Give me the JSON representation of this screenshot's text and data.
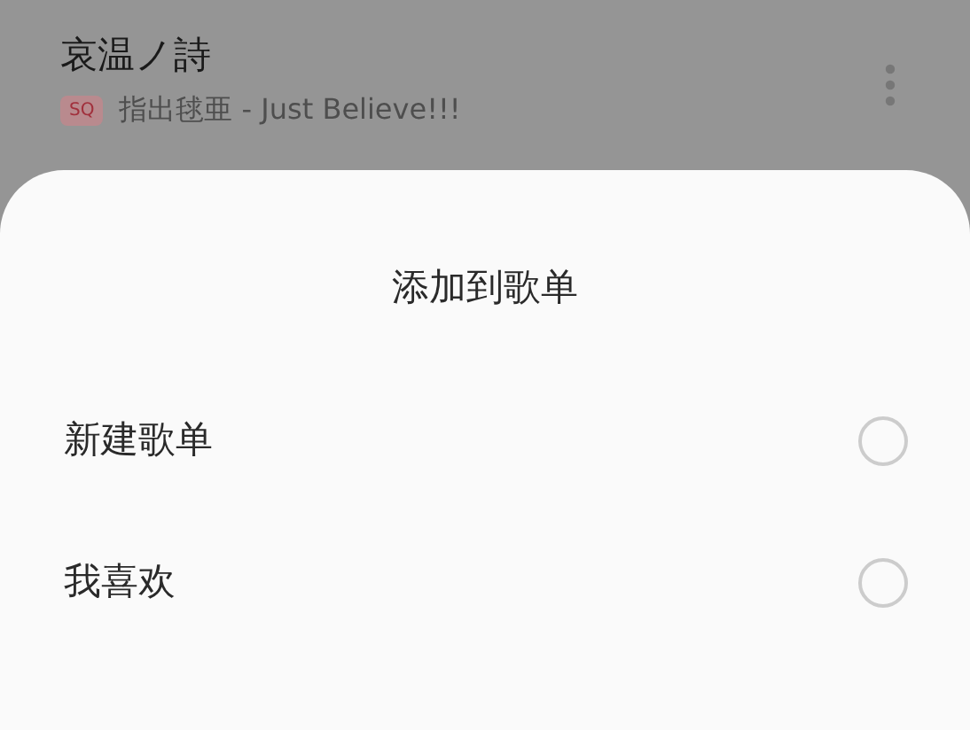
{
  "song": {
    "title": "哀温ノ詩",
    "quality_badge": "SQ",
    "artist_line": "指出毬亜 - Just Believe!!!"
  },
  "sheet": {
    "title": "添加到歌单",
    "options": [
      {
        "label": "新建歌单",
        "selected": false
      },
      {
        "label": "我喜欢",
        "selected": false
      }
    ]
  }
}
